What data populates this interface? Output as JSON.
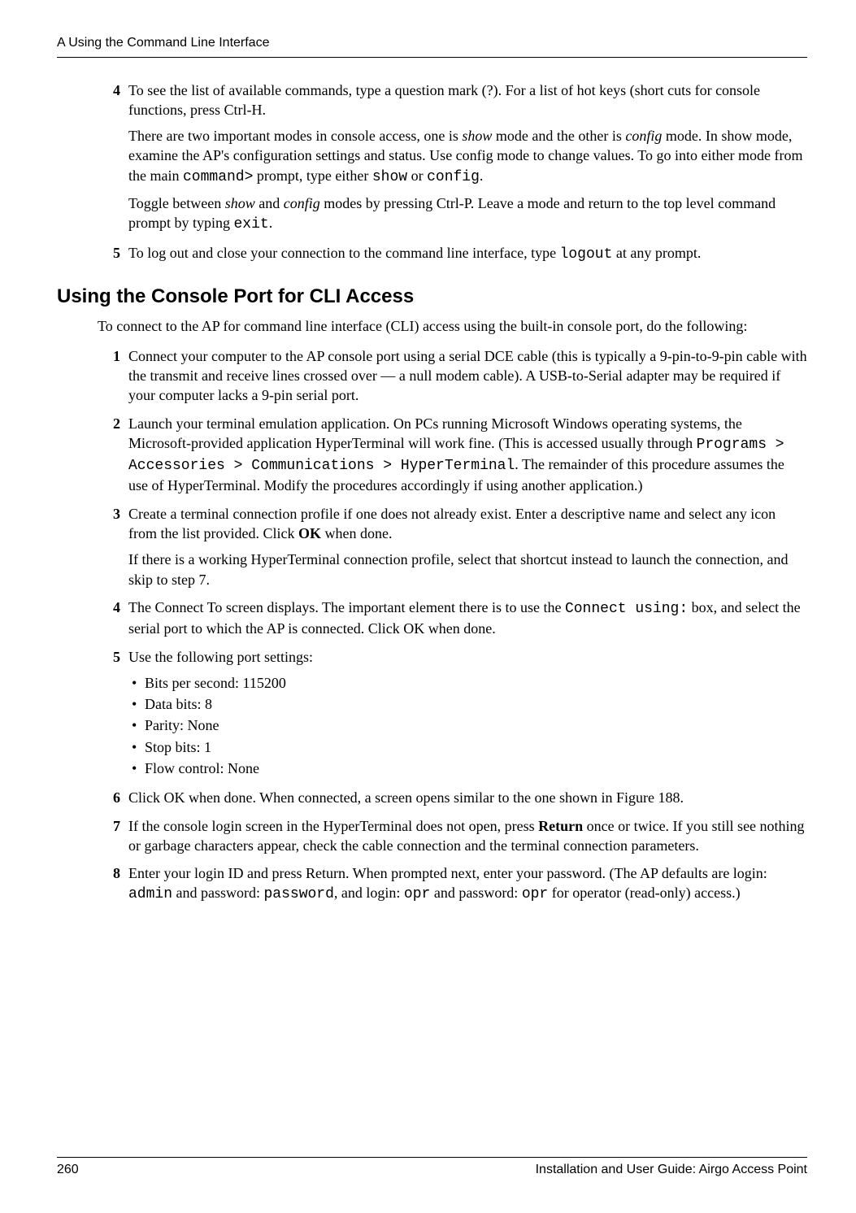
{
  "header": {
    "running": "A  Using the Command Line Interface"
  },
  "steps_a": {
    "s4": {
      "num": "4",
      "p1a": "To see the list of available commands, type a question mark (?). For a list of hot keys (short cuts for console functions, press Ctrl-H.",
      "p2a": "There are two important modes in console access, one is ",
      "p2b": "show",
      "p2c": " mode and the other is ",
      "p2d": "config",
      "p2e": " mode. In show mode, examine the AP's configuration settings and status. Use config mode to change values. To go into either mode from the main ",
      "p2f": "command>",
      "p2g": " prompt, type either ",
      "p2h": "show",
      "p2i": " or ",
      "p2j": "config",
      "p2k": ".",
      "p3a": "Toggle between ",
      "p3b": "show",
      "p3c": " and ",
      "p3d": "config",
      "p3e": " modes by pressing Ctrl-P. Leave a mode and return to the top level command prompt by typing ",
      "p3f": "exit",
      "p3g": "."
    },
    "s5": {
      "num": "5",
      "a": "To log out and close your connection to the command line interface, type ",
      "b": "logout",
      "c": " at any prompt."
    }
  },
  "section_title": "Using the Console Port for CLI Access",
  "section_lead": "To connect to the AP for command line interface (CLI) access using the built-in console port, do the following:",
  "steps_b": {
    "s1": {
      "num": "1",
      "t": "Connect your computer to the AP console port using a serial DCE cable (this is typically a 9-pin-to-9-pin cable with the transmit and receive lines crossed over — a null modem cable). A USB-to-Serial adapter may be required if your computer lacks a 9-pin serial port."
    },
    "s2": {
      "num": "2",
      "a": "Launch your terminal emulation application. On PCs running Microsoft Windows operating systems, the Microsoft-provided application HyperTerminal will work fine. (This is accessed usually through ",
      "b": "Programs > Accessories > Communications > HyperTerminal",
      "c": ". The remainder of this procedure assumes the use of HyperTerminal. Modify the procedures accordingly if using another application.)"
    },
    "s3": {
      "num": "3",
      "a": "Create a terminal connection profile if one does not already exist. Enter a descriptive name and select any icon from the list provided. Click ",
      "b": "OK",
      "c": " when done.",
      "p2": "If there is a working HyperTerminal connection profile, select that shortcut instead to launch the connection, and skip to step 7."
    },
    "s4": {
      "num": "4",
      "a": "The Connect To screen displays. The important element there is to use the ",
      "b": "Connect using:",
      "c": " box, and select the serial port to which the AP is connected. Click OK when done."
    },
    "s5": {
      "num": "5",
      "t": "Use the following port settings:",
      "b1": "Bits per second: 115200",
      "b2": "Data bits: 8",
      "b3": "Parity: None",
      "b4": "Stop bits: 1",
      "b5": "Flow control: None"
    },
    "s6": {
      "num": "6",
      "t": "Click OK when done. When connected, a screen opens similar to the one shown in Figure 188."
    },
    "s7": {
      "num": "7",
      "a": "If the console login screen in the HyperTerminal does not open, press ",
      "b": "Return",
      "c": " once or twice. If you still see nothing or garbage characters appear, check the cable connection and the terminal connection parameters."
    },
    "s8": {
      "num": "8",
      "a": "Enter your login ID and press Return. When prompted next, enter your password. (The AP defaults are login: ",
      "b": "admin",
      "c": " and password: ",
      "d": "password",
      "e": ", and login: ",
      "f": "opr",
      "g": " and password: ",
      "h": "opr",
      "i": " for operator (read-only) access.)"
    }
  },
  "footer": {
    "page": "260",
    "title": "Installation and User Guide: Airgo Access Point"
  }
}
